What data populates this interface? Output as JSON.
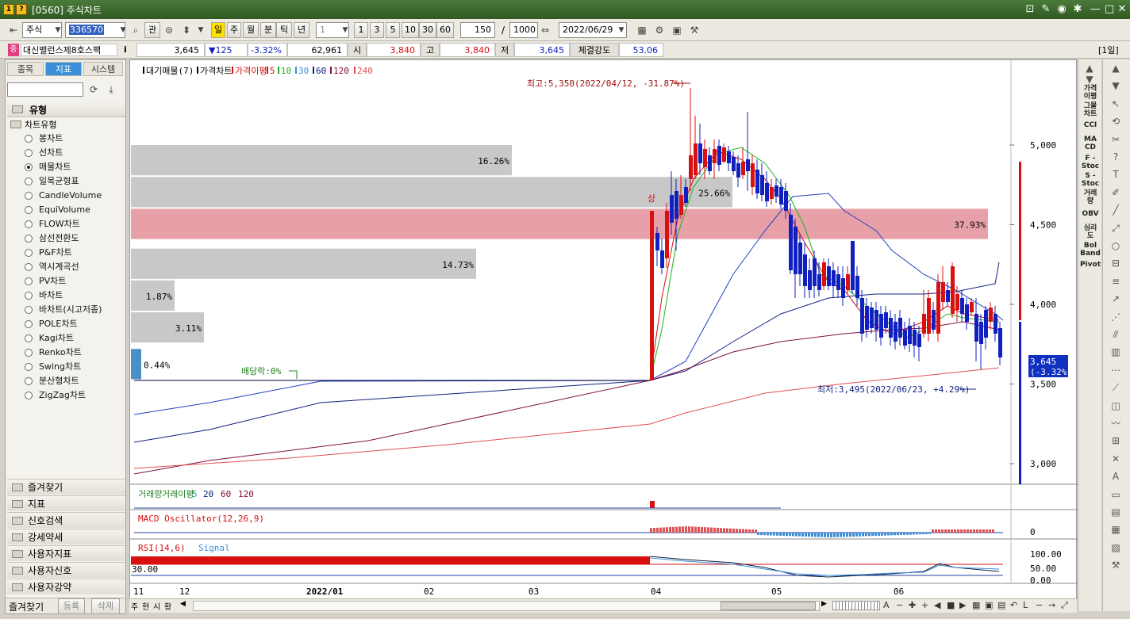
{
  "window": {
    "title": "[0560] 주식차트",
    "icons": [
      "1",
      "?"
    ]
  },
  "toolbar": {
    "market": "주식",
    "code": "336570",
    "btn_gwan": "관",
    "periods": [
      "일",
      "주",
      "월",
      "분",
      "틱",
      "년"
    ],
    "interval_select": "1",
    "quick_intervals": [
      "1",
      "3",
      "5",
      "10",
      "30",
      "60"
    ],
    "view_count": "150",
    "slash": "/",
    "max_count": "1000",
    "date": "2022/06/29"
  },
  "quote": {
    "stock_name": "대신밸런스제8호스팩",
    "badge": "증",
    "info": "i",
    "price": "3,645",
    "change": "▼125",
    "change_pct": "-3.32%",
    "volume": "62,961",
    "open_label": "시",
    "open": "3,840",
    "high_label": "고",
    "high": "3,840",
    "low_label": "저",
    "low": "3,645",
    "strength_label": "체결강도",
    "strength": "53.06",
    "period_tag": "[1일]"
  },
  "left": {
    "tabs": [
      "종목",
      "지표",
      "시스템"
    ],
    "section": "유형",
    "group": "차트유형",
    "items": [
      "봉차트",
      "선차트",
      "매물차트",
      "일목균형표",
      "CandleVolume",
      "EquiVolume",
      "FLOW차트",
      "삼선전환도",
      "P&F차트",
      "역시계곡선",
      "PV차트",
      "바차트",
      "바차트(시고저종)",
      "POLE차트",
      "Kagi차트",
      "Renko차트",
      "Swing차트",
      "분산형차트",
      "ZigZag차트"
    ],
    "selected": "매물차트",
    "categories": [
      "즐겨찾기",
      "지표",
      "신호검색",
      "강세약세",
      "사용자지표",
      "사용자신호",
      "사용자강약"
    ],
    "footer": [
      "즐겨찾기",
      "등록",
      "삭제"
    ]
  },
  "chart_data": {
    "type": "candlestick",
    "legend_main": [
      "대기매물(7)",
      "가격차트",
      "가격이평",
      "5",
      "10",
      "30",
      "60",
      "120",
      "240"
    ],
    "y_ticks": [
      "5,000",
      "4,500",
      "4,000",
      "3,500",
      "3,000"
    ],
    "y_values": [
      5000,
      4500,
      4000,
      3500,
      3000
    ],
    "x_ticks": [
      "11",
      "12",
      "2022/01",
      "02",
      "03",
      "04",
      "05",
      "06"
    ],
    "volume_profile": [
      {
        "price_lo": 4800,
        "price_hi": 5000,
        "pct": "16.26%"
      },
      {
        "price_lo": 4600,
        "price_hi": 4800,
        "pct": "25.66%"
      },
      {
        "price_lo": 4400,
        "price_hi": 4600,
        "pct": "37.93%"
      },
      {
        "price_lo": 4150,
        "price_hi": 4350,
        "pct": "14.73%"
      },
      {
        "price_lo": 3950,
        "price_hi": 4150,
        "pct": "1.87%"
      },
      {
        "price_lo": 3750,
        "price_hi": 3950,
        "pct": "3.11%"
      },
      {
        "price_lo": 3520,
        "price_hi": 3720,
        "pct": "0.44%"
      }
    ],
    "annotations": {
      "high": "최고:5,350(2022/04/12, -31.87%)",
      "low": "최저:3,495(2022/06/23, +4.29%)",
      "dividend": "배당락:0%",
      "limit_up": "상",
      "last_price": "3,645",
      "last_pct": "(-3.32%)"
    },
    "volume_legend": [
      "거래량",
      "거래이평",
      "5",
      "20",
      "60",
      "120"
    ],
    "macd_legend": "MACD Oscillator(12,26,9)",
    "macd_tick": "0",
    "rsi_legend": [
      "RSI(14,6)",
      "Signal"
    ],
    "rsi_ticks": [
      "100.00",
      "50.00",
      "0.00"
    ],
    "rsi_level": "30.00"
  },
  "right_labels": [
    "가격\n이평",
    "그물\n차트",
    "CCI",
    "MA\nCD",
    "F -\nStoc",
    "S -\nStoc",
    "거래\n량",
    "OBV",
    "심리\n도",
    "Bol\nBand",
    "Pivot"
  ],
  "bottom": {
    "tabs": [
      "주",
      "현",
      "시",
      "황"
    ]
  },
  "colors": {
    "up": "#d81010",
    "down": "#1020c0",
    "vp_bar": "#c8c8c8",
    "vp_max": "#e8a0a8",
    "accent": "#3a8fd8"
  }
}
